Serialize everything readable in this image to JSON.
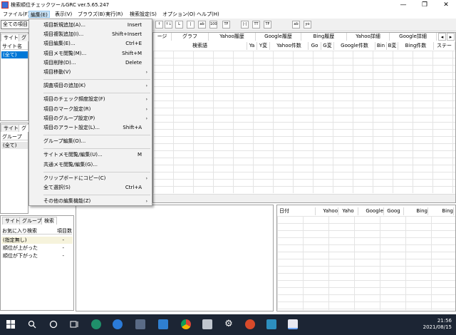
{
  "window": {
    "title": "検索順位チェックツールGRC  ver.5.65.247",
    "minimize": "—",
    "maximize": "❐",
    "close": "✕"
  },
  "menubar": [
    "ファイル(F)",
    "編集(E)",
    "表示(V)",
    "ブラウズ(B)",
    "実行(R)",
    "検索設定(S)",
    "オプション(O)",
    "ヘルプ(H)"
  ],
  "toolbar": {
    "combo_value": "全ての項目",
    "buttons": [
      "↑",
      "↑↓",
      "L",
      "|",
      "ab",
      "100",
      "TF",
      "|-|",
      "TT",
      "TF",
      "ab",
      "yo"
    ]
  },
  "main_tabs": {
    "left": [
      "サイト",
      "グル"
    ],
    "page_tab": "ージ",
    "groups": [
      "グラフ",
      "Yahoo履歴",
      "Google履歴",
      "Bing履歴",
      "Yahoo詳細",
      "Google詳細"
    ],
    "nav_left": "◂",
    "nav_right": "▸"
  },
  "main_columns": [
    "検索語",
    "Ya",
    "Y変",
    "Yahoo件数",
    "Go",
    "G変",
    "Google件数",
    "Bin",
    "B変",
    "Bing件数",
    "ステー"
  ],
  "site_pane": {
    "header": "サイト名",
    "rows": [
      "(全て)"
    ]
  },
  "group_pane": {
    "tabs": [
      "サイト",
      "グル"
    ],
    "header": "グループ",
    "rows": [
      "(全て)"
    ]
  },
  "search_pane": {
    "tabs": [
      "サイト",
      "グループ",
      "検索"
    ],
    "columns": [
      "お気に入り検索",
      "項目数"
    ],
    "rows": [
      {
        "name": "(指定無し)",
        "count": "-"
      },
      {
        "name": "順位が上がった",
        "count": "-"
      },
      {
        "name": "順位が下がった",
        "count": "-"
      }
    ]
  },
  "history_pane": {
    "columns": [
      "日付",
      "Yahoo",
      "Yaho",
      "Google",
      "Goog",
      "Bing",
      "Bing"
    ]
  },
  "edit_menu": [
    {
      "label": "項目新規追加(A)...",
      "shortcut": "Insert"
    },
    {
      "label": "項目複製追加(I)...",
      "shortcut": "Shift+Insert"
    },
    {
      "label": "項目編集(E)...",
      "shortcut": "Ctrl+E"
    },
    {
      "label": "項目メモ閲覧(M)...",
      "shortcut": "Shift+M"
    },
    {
      "label": "項目削除(D)...",
      "shortcut": "Delete"
    },
    {
      "label": "項目移動(V)",
      "shortcut": "",
      "submenu": true
    },
    {
      "sep": true
    },
    {
      "label": "調査項目の追加(K)",
      "shortcut": "",
      "submenu": true
    },
    {
      "sep": true
    },
    {
      "label": "項目のチェック頻度設定(F)",
      "shortcut": "",
      "submenu": true
    },
    {
      "label": "項目のマーク設定(R)",
      "shortcut": "",
      "submenu": true
    },
    {
      "label": "項目のグループ設定(P)",
      "shortcut": "",
      "submenu": true
    },
    {
      "label": "項目のアラート設定(L)...",
      "shortcut": "Shift+A"
    },
    {
      "sep": true
    },
    {
      "label": "グループ編集(O)...",
      "shortcut": ""
    },
    {
      "sep": true
    },
    {
      "label": "サイトメモ閲覧/編集(U)...",
      "shortcut": "M"
    },
    {
      "label": "共通メモ閲覧/編集(G)...",
      "shortcut": ""
    },
    {
      "sep": true
    },
    {
      "label": "クリップボードにコピー(C)",
      "shortcut": "",
      "submenu": true
    },
    {
      "label": "全て選択(S)",
      "shortcut": "Ctrl+A"
    },
    {
      "sep": true
    },
    {
      "label": "その他の編集機能(Z)",
      "shortcut": "",
      "submenu": true
    }
  ],
  "taskbar": {
    "time": "21:56",
    "date": "2021/08/15",
    "icons": [
      "windows-icon",
      "search-icon",
      "cortana-icon",
      "task-view-icon",
      "edge-icon",
      "edge-icon",
      "store-icon",
      "mail-icon",
      "chrome-icon",
      "app-icon",
      "settings-icon",
      "app-icon",
      "chart-icon",
      "grc-icon"
    ],
    "colors": {
      "bg": "#1c2534",
      "selection": "#0078d7",
      "menu_highlight": "#cce4f7"
    }
  }
}
